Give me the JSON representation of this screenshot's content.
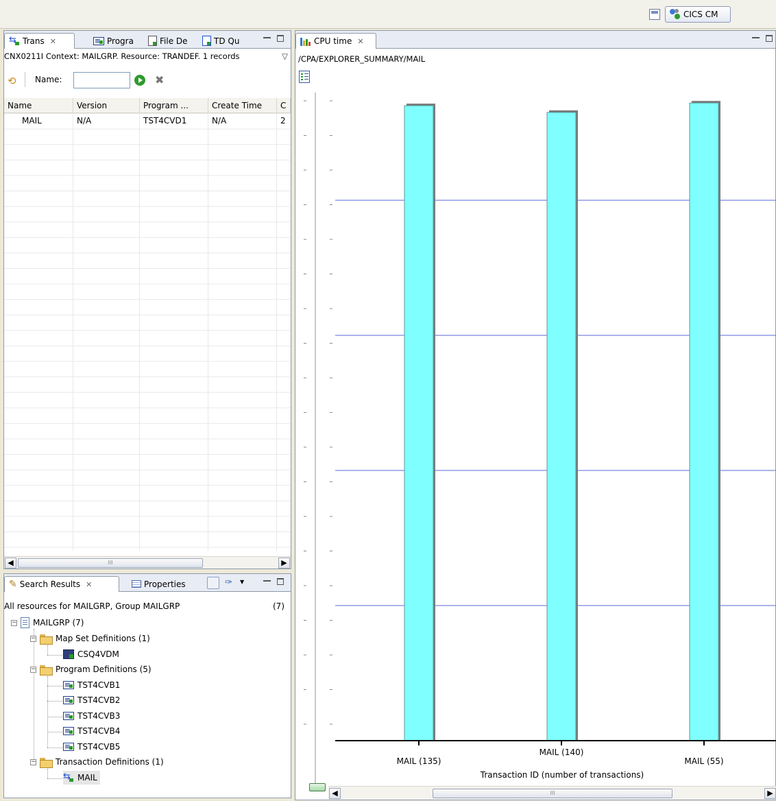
{
  "toolbar": {
    "perspective_label": "CICS CM"
  },
  "left_panel": {
    "tabs": [
      {
        "label": "Trans"
      },
      {
        "label": "Progra"
      },
      {
        "label": "File De"
      },
      {
        "label": "TD Qu"
      }
    ],
    "context_message": "CNX0211I Context: MAILGRP. Resource: TRANDEF. 1 records",
    "filter_label": "Name:",
    "filter_value": "",
    "columns": [
      "Name",
      "Version",
      "Program ...",
      "Create Time",
      "C"
    ],
    "rows": [
      {
        "name": "MAIL",
        "version": "N/A",
        "program": "TST4CVD1",
        "create_time": "N/A",
        "extra": "2"
      }
    ],
    "scroll_thumb": "III"
  },
  "search_panel": {
    "tabs": [
      {
        "label": "Search Results"
      },
      {
        "label": "Properties"
      }
    ],
    "header_text": "All resources for MAILGRP, Group MAILGRP",
    "header_count": "(7)",
    "tree": {
      "root": "MAILGRP (7)",
      "groups": [
        {
          "label": "Map Set Definitions (1)",
          "items": [
            "CSQ4VDM"
          ]
        },
        {
          "label": "Program Definitions (5)",
          "items": [
            "TST4CVB1",
            "TST4CVB2",
            "TST4CVB3",
            "TST4CVB4",
            "TST4CVB5"
          ]
        },
        {
          "label": "Transaction Definitions (1)",
          "items": [
            "MAIL"
          ]
        }
      ]
    }
  },
  "chart_panel": {
    "tab_label": "CPU time",
    "path": "/CPA/EXPLORER_SUMMARY/MAIL",
    "scroll_thumb": "III"
  },
  "chart_data": {
    "type": "bar",
    "title": "",
    "xlabel": "Transaction ID (number of transactions)",
    "ylabel": "",
    "categories": [
      "MAIL (135)",
      "MAIL (140)",
      "MAIL (55)"
    ],
    "values": [
      4.7,
      4.65,
      4.72
    ],
    "ylim": [
      0,
      5
    ],
    "grid": true,
    "colors": {
      "bar": "#7fffff",
      "bar_edge": "#5a9a9a",
      "bar_shadow": "#7a7a7a",
      "grid": "#5a6ad8",
      "axis": "#000000"
    }
  }
}
